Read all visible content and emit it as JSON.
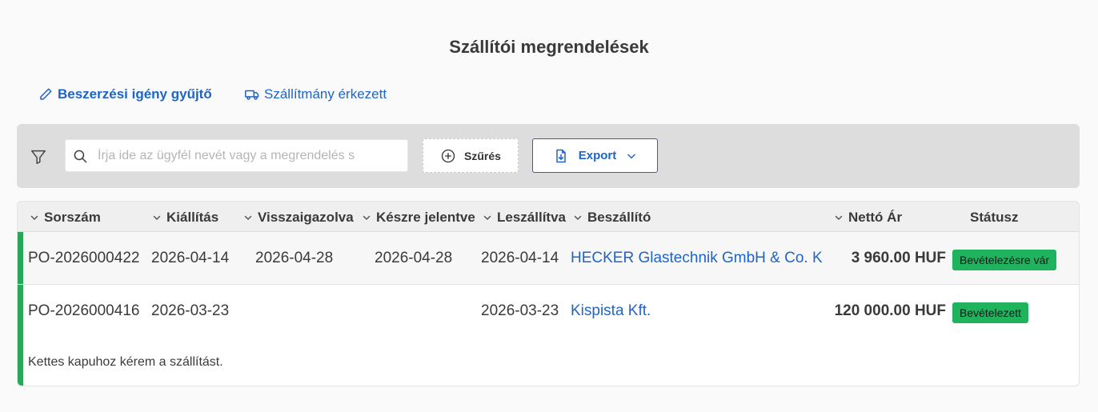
{
  "page": {
    "title": "Szállítói megrendelések"
  },
  "actions": {
    "collector": "Beszerzési igény gyűjtő",
    "shipment_arrived": "Szállítmány érkezett"
  },
  "toolbar": {
    "search_placeholder": "Írja ide az ügyfél nevét vagy a megrendelés s",
    "filter_label": "Szűrés",
    "export_label": "Export"
  },
  "table": {
    "columns": {
      "number": "Sorszám",
      "issued": "Kiállítás",
      "confirmed": "Visszaigazolva",
      "reported_ready": "Készre jelentve",
      "delivered": "Leszállítva",
      "supplier": "Beszállító",
      "net_price": "Nettó Ár",
      "status": "Státusz"
    },
    "rows": [
      {
        "number": "PO-2026000422",
        "issued": "2026-04-14",
        "confirmed": "2026-04-28",
        "reported_ready": "2026-04-28",
        "delivered": "2026-04-14",
        "supplier": "HECKER Glastechnik GmbH & Co. K",
        "net_price": "3 960.00 HUF",
        "status": "Bevételezésre vár",
        "note": ""
      },
      {
        "number": "PO-2026000416",
        "issued": "2026-03-23",
        "confirmed": "",
        "reported_ready": "",
        "delivered": "2026-03-23",
        "supplier": "Kispista Kft.",
        "net_price": "120 000.00 HUF",
        "status": "Bevételezett",
        "note": "Kettes kapuhoz kérem a szállítást."
      }
    ]
  },
  "colors": {
    "accent": "#1f64c8",
    "row_indicator": "#2aa55a",
    "status_badge": "#1fb35e",
    "toolbar_bg": "#dddddd"
  },
  "icons": {
    "collector": "pencil-icon",
    "shipment": "truck-icon",
    "toolbar_filter": "funnel-icon",
    "search": "search-icon",
    "filter_button": "plus-circle-icon",
    "export_doc": "file-download-icon",
    "export_chevron": "chevron-down-icon",
    "sort": "chevron-down-icon"
  }
}
